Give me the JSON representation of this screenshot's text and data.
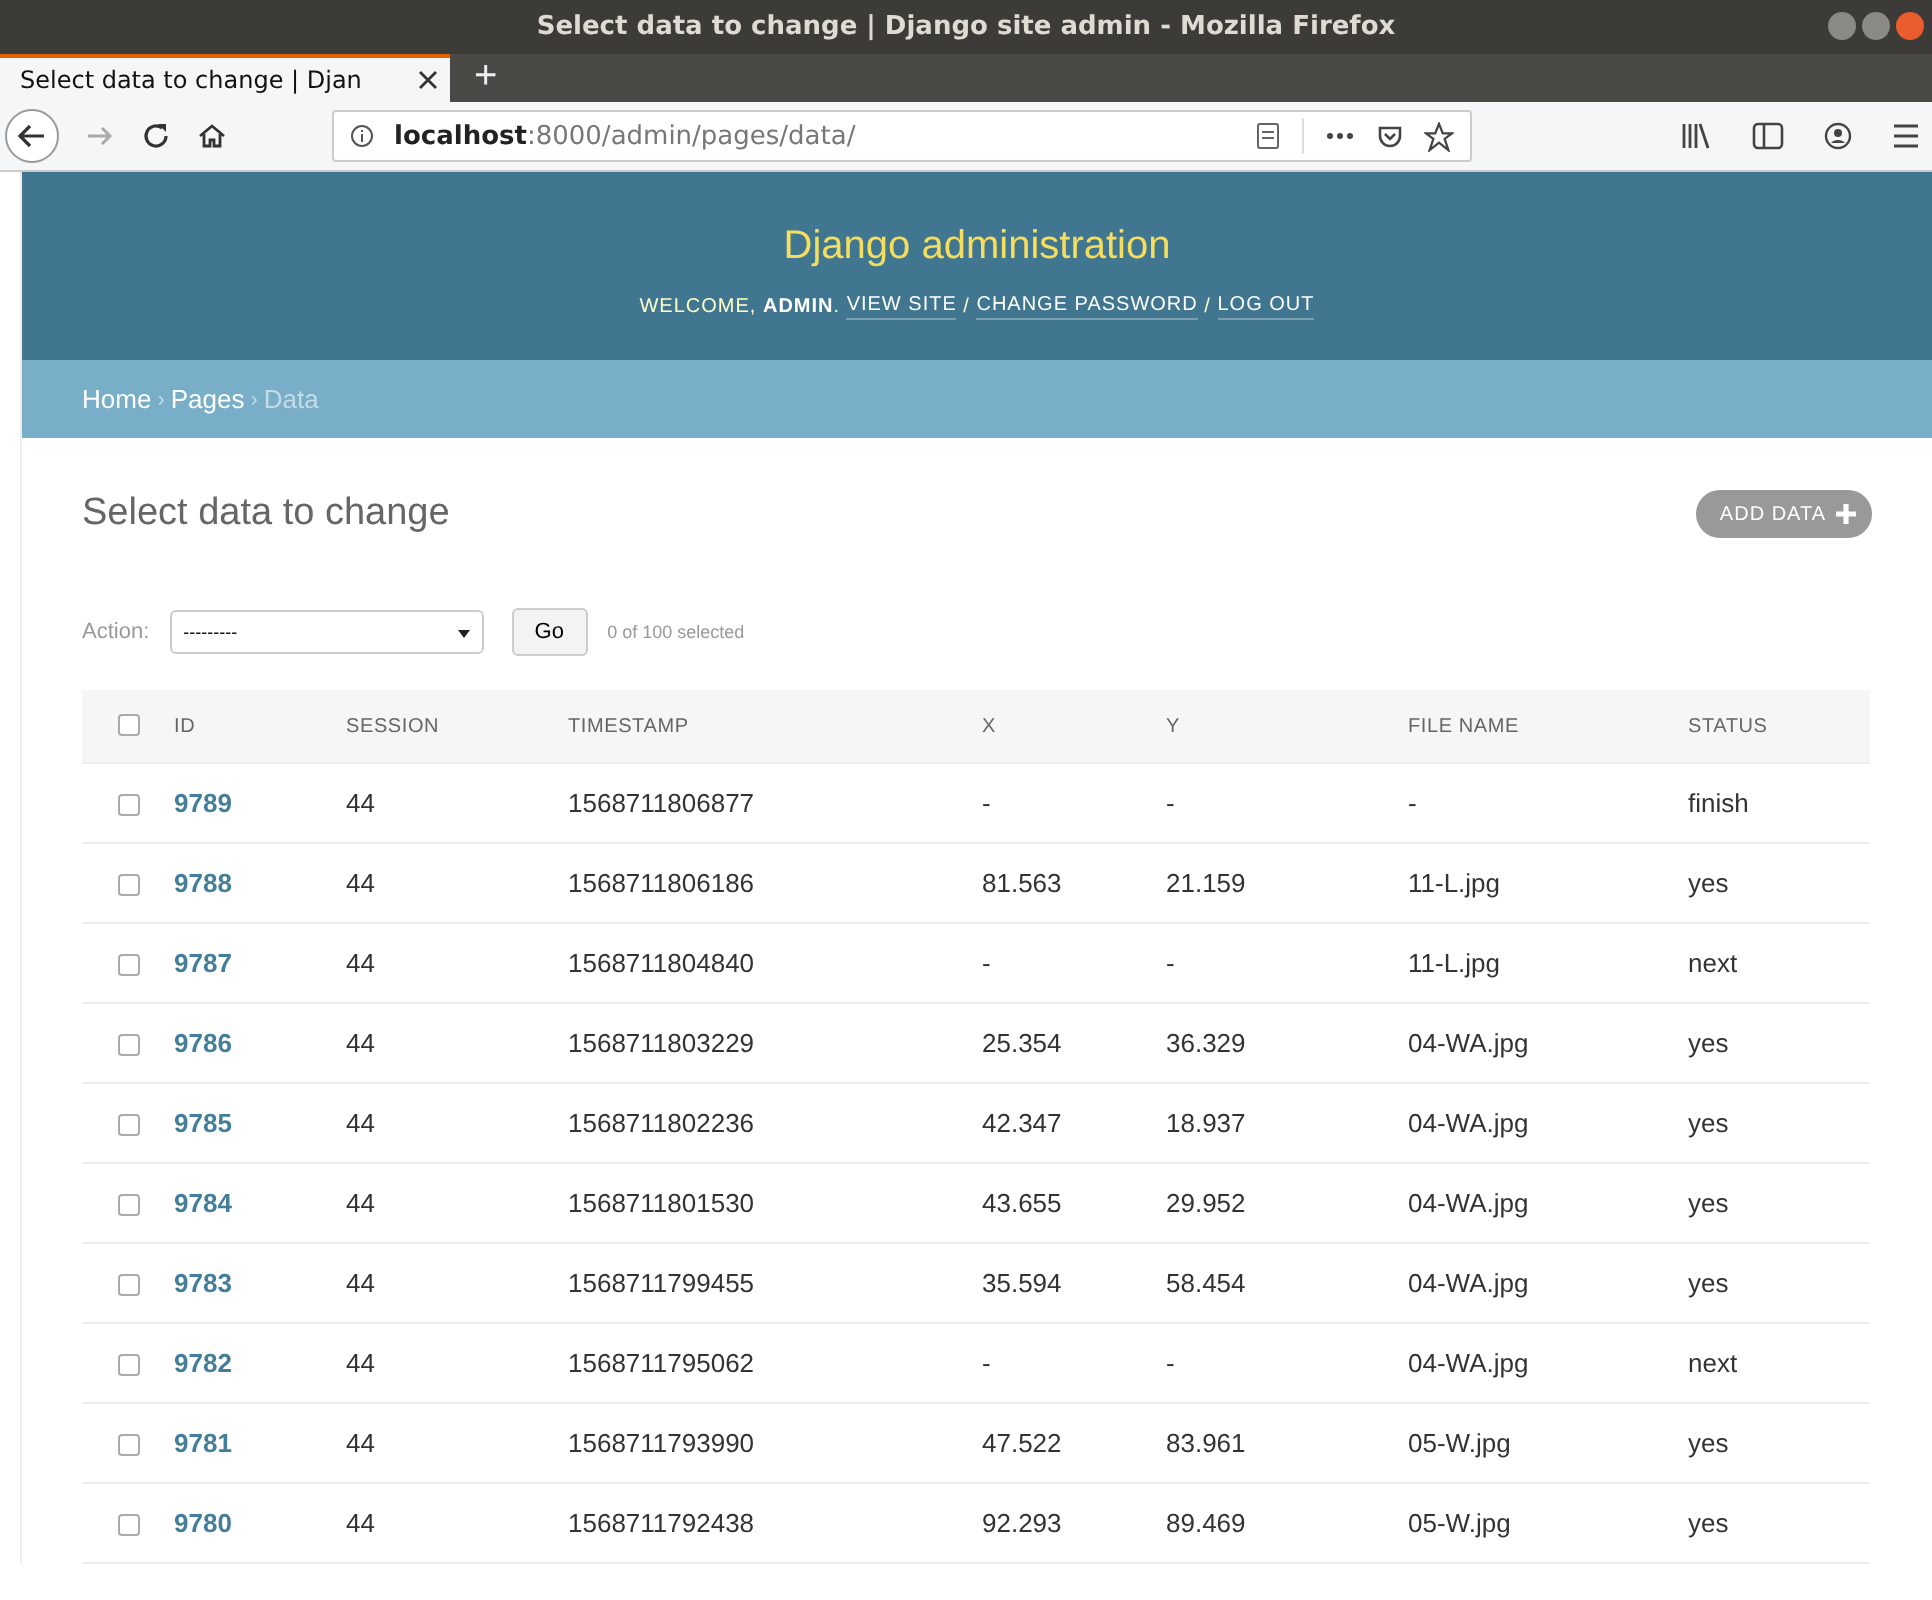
{
  "window": {
    "title": "Select data to change | Django site admin - Mozilla Firefox"
  },
  "tabs": [
    {
      "label": "Select data to change | Djan",
      "selected": true
    }
  ],
  "new_tab": "+",
  "address_bar": {
    "host": "localhost",
    "path": ":8000/admin/pages/data/"
  },
  "header": {
    "title": "Django administration",
    "welcome": "WELCOME, ",
    "user": "ADMIN",
    "after_user": ". ",
    "links": [
      "VIEW SITE",
      "CHANGE PASSWORD",
      "LOG OUT"
    ],
    "separator": " / "
  },
  "breadcrumbs": [
    {
      "label": "Home",
      "current": false
    },
    {
      "label": "Pages",
      "current": false
    },
    {
      "label": "Data",
      "current": true
    }
  ],
  "breadcrumb_separator": "›",
  "page_title": "Select data to change",
  "add_button": "ADD DATA",
  "actions": {
    "label": "Action:",
    "value": "---------",
    "go": "Go",
    "counter": "0 of 100 selected"
  },
  "table": {
    "columns": [
      "ID",
      "SESSION",
      "TIMESTAMP",
      "X",
      "Y",
      "FILE NAME",
      "STATUS"
    ],
    "all_checked": false,
    "rows": [
      {
        "checked": false,
        "cells": [
          "9789",
          "44",
          "1568711806877",
          "-",
          "-",
          "-",
          "finish"
        ]
      },
      {
        "checked": false,
        "cells": [
          "9788",
          "44",
          "1568711806186",
          "81.563",
          "21.159",
          "11-L.jpg",
          "yes"
        ]
      },
      {
        "checked": false,
        "cells": [
          "9787",
          "44",
          "1568711804840",
          "-",
          "-",
          "11-L.jpg",
          "next"
        ]
      },
      {
        "checked": false,
        "cells": [
          "9786",
          "44",
          "1568711803229",
          "25.354",
          "36.329",
          "04-WA.jpg",
          "yes"
        ]
      },
      {
        "checked": false,
        "cells": [
          "9785",
          "44",
          "1568711802236",
          "42.347",
          "18.937",
          "04-WA.jpg",
          "yes"
        ]
      },
      {
        "checked": false,
        "cells": [
          "9784",
          "44",
          "1568711801530",
          "43.655",
          "29.952",
          "04-WA.jpg",
          "yes"
        ]
      },
      {
        "checked": false,
        "cells": [
          "9783",
          "44",
          "1568711799455",
          "35.594",
          "58.454",
          "04-WA.jpg",
          "yes"
        ]
      },
      {
        "checked": false,
        "cells": [
          "9782",
          "44",
          "1568711795062",
          "-",
          "-",
          "04-WA.jpg",
          "next"
        ]
      },
      {
        "checked": false,
        "cells": [
          "9781",
          "44",
          "1568711793990",
          "47.522",
          "83.961",
          "05-W.jpg",
          "yes"
        ]
      },
      {
        "checked": false,
        "cells": [
          "9780",
          "44",
          "1568711792438",
          "92.293",
          "89.469",
          "05-W.jpg",
          "yes"
        ]
      }
    ]
  }
}
